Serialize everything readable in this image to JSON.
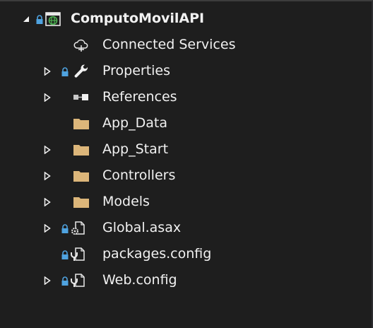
{
  "solution_explorer": {
    "project": {
      "name": "ComputoMovilAPI",
      "expanded": true,
      "icon": "globe-project-icon"
    },
    "items": [
      {
        "label": "Connected Services",
        "icon": "cloud-icon",
        "expandable": false,
        "locked": false
      },
      {
        "label": "Properties",
        "icon": "wrench-icon",
        "expandable": true,
        "locked": true
      },
      {
        "label": "References",
        "icon": "references-icon",
        "expandable": true,
        "locked": false
      },
      {
        "label": "App_Data",
        "icon": "folder-icon",
        "expandable": false,
        "locked": false
      },
      {
        "label": "App_Start",
        "icon": "folder-icon",
        "expandable": true,
        "locked": false
      },
      {
        "label": "Controllers",
        "icon": "folder-icon",
        "expandable": true,
        "locked": false
      },
      {
        "label": "Models",
        "icon": "folder-icon",
        "expandable": true,
        "locked": false
      },
      {
        "label": "Global.asax",
        "icon": "gear-file-icon",
        "expandable": true,
        "locked": true
      },
      {
        "label": "packages.config",
        "icon": "config-file-icon",
        "expandable": false,
        "locked": true
      },
      {
        "label": "Web.config",
        "icon": "config-file-icon",
        "expandable": true,
        "locked": true
      }
    ]
  },
  "colors": {
    "background": "#1e1e1e",
    "text": "#f1f1f1",
    "folder": "#dcb67a",
    "lock": "#4fa3e0",
    "icon_outline": "#e8e8e8",
    "globe": "#4caf50"
  }
}
